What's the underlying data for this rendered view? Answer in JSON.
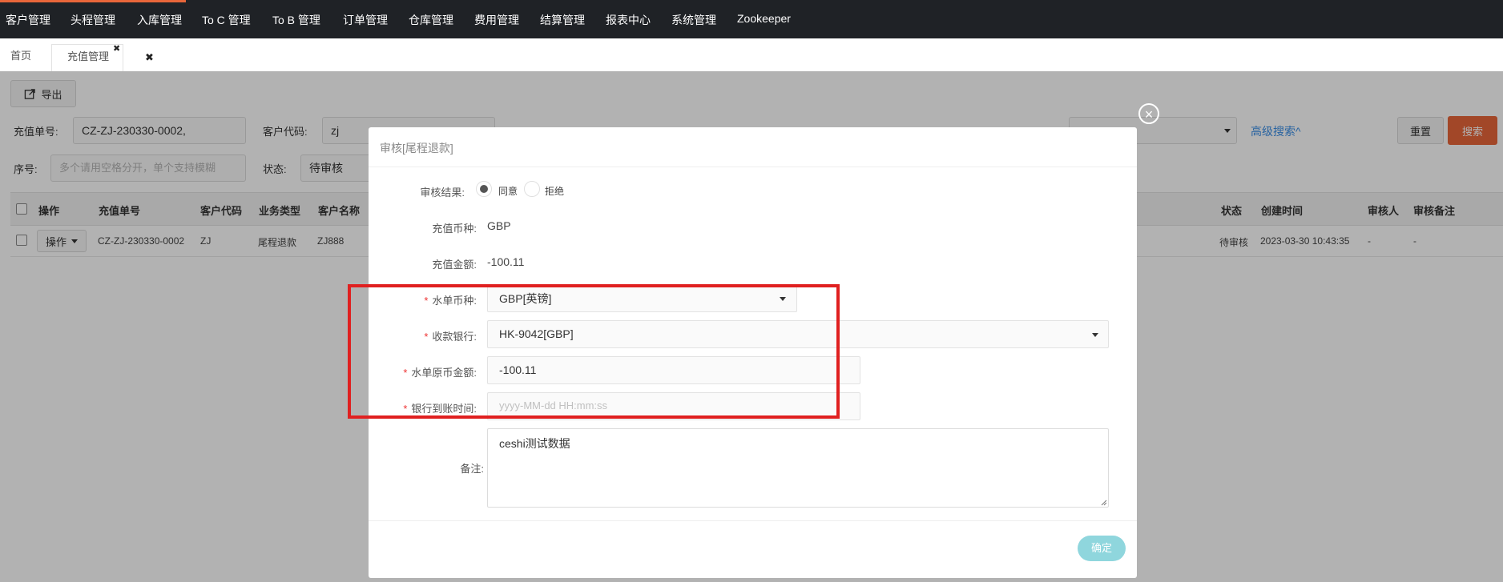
{
  "nav": {
    "items": [
      "客户管理",
      "头程管理",
      "入库管理",
      "To C 管理",
      "To B 管理",
      "订单管理",
      "仓库管理",
      "费用管理",
      "结算管理",
      "报表中心",
      "系统管理",
      "Zookeeper"
    ],
    "accent_color": "#e8663a"
  },
  "tabs": {
    "home": "首页",
    "current": "充值管理",
    "close_glyph": "✖"
  },
  "toolbar": {
    "export_label": "导出"
  },
  "filters": {
    "recharge_no_label": "充值单号:",
    "recharge_no_value": "CZ-ZJ-230330-0002,",
    "customer_code_label": "客户代码:",
    "customer_code_value": "zj",
    "seq_label": "序号:",
    "seq_placeholder": "多个请用空格分开，单个支持模糊",
    "status_label": "状态:",
    "status_value": "待审核",
    "advanced_search": "高级搜索^",
    "reset_label": "重置",
    "search_label": "搜索",
    "search_color": "#e8663a"
  },
  "table": {
    "headers_left": [
      "操作",
      "充值单号",
      "客户代码",
      "业务类型",
      "客户名称"
    ],
    "headers_right": [
      "状态",
      "创建时间",
      "审核人",
      "审核备注"
    ],
    "rows": [
      {
        "action": "操作",
        "no": "CZ-ZJ-230330-0002",
        "code": "ZJ",
        "type": "尾程退款",
        "name": "ZJ888",
        "status": "待审核",
        "created": "2023-03-30 10:43:35",
        "auditor": "-",
        "remark": "-"
      }
    ]
  },
  "modal": {
    "title": "审核[尾程退款]",
    "close_glyph": "×",
    "audit_result_label": "审核结果:",
    "radio_agree": "同意",
    "radio_reject": "拒绝",
    "currency_label": "充值币种:",
    "currency_value": "GBP",
    "amount_label": "充值金额:",
    "amount_value": "-100.11",
    "required_mark": "*",
    "water_currency_label": "水单币种:",
    "water_currency_value": "GBP[英镑]",
    "bank_label": "收款银行:",
    "bank_value": "HK-9042[GBP]",
    "orig_amount_label": "水单原币金额:",
    "orig_amount_value": "-100.11",
    "arrival_time_label": "银行到账时间:",
    "arrival_time_placeholder": "yyyy-MM-dd HH:mm:ss",
    "remark_label": "备注:",
    "remark_value": "ceshi测试数据",
    "confirm_label": "确定",
    "confirm_color": "#8fd6dd",
    "highlight_color": "#e02020"
  }
}
